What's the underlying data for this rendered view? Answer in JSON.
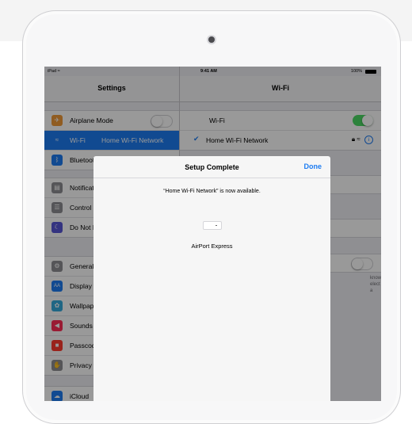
{
  "status_bar": {
    "carrier": "iPad ≈",
    "time": "9:41 AM",
    "battery": "100%"
  },
  "left_pane": {
    "title": "Settings",
    "items": [
      {
        "label": "Airplane Mode",
        "icon": "airplane-icon",
        "color": "#f19a37"
      },
      {
        "label": "Wi-Fi",
        "value": "Home Wi-Fi Network",
        "icon": "wifi-icon",
        "color": "#1d7cf2"
      },
      {
        "label": "Bluetooth",
        "icon": "bluetooth-icon",
        "color": "#1d7cf2"
      },
      {
        "label": "Notifications",
        "icon": "notifications-icon",
        "color": "#8e8e93"
      },
      {
        "label": "Control Center",
        "icon": "control-center-icon",
        "color": "#8e8e93"
      },
      {
        "label": "Do Not Disturb",
        "icon": "moon-icon",
        "color": "#5856d6"
      },
      {
        "label": "General",
        "icon": "gear-icon",
        "color": "#8e8e93"
      },
      {
        "label": "Display & Brightness",
        "icon": "display-icon",
        "color": "#1d7cf2"
      },
      {
        "label": "Wallpaper",
        "icon": "wallpaper-icon",
        "color": "#34aadc"
      },
      {
        "label": "Sounds",
        "icon": "speaker-icon",
        "color": "#ff2d55"
      },
      {
        "label": "Passcode",
        "icon": "lock-icon",
        "color": "#ff3b30"
      },
      {
        "label": "Privacy",
        "icon": "hand-icon",
        "color": "#8e8e93"
      },
      {
        "label": "iCloud",
        "icon": "cloud-icon",
        "color": "#1d7cf2"
      }
    ]
  },
  "right_pane": {
    "title": "Wi-Fi",
    "wifi_toggle_label": "Wi-Fi",
    "connected_network": "Home Wi-Fi Network",
    "partial_text": "known\nelect a"
  },
  "modal": {
    "title": "Setup Complete",
    "done_label": "Done",
    "message": "“Home Wi-Fi Network” is now available.",
    "device_name": "AirPort Express"
  },
  "colors": {
    "accent": "#1d7cf2",
    "toggle_on": "#4cd964"
  }
}
